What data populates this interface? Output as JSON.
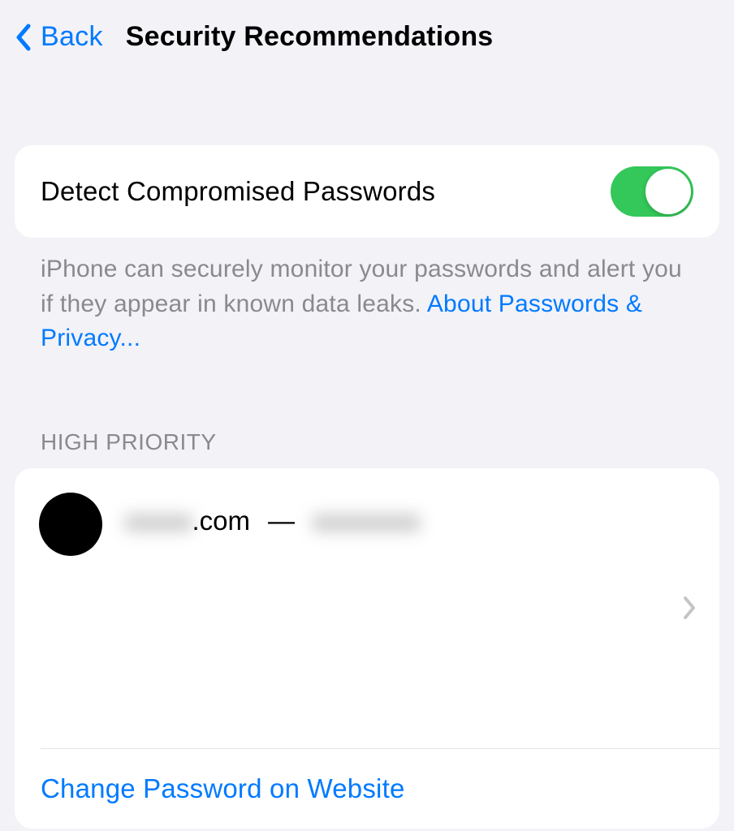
{
  "nav": {
    "back_label": "Back",
    "title": "Security Recommendations"
  },
  "detect_row": {
    "label": "Detect Compromised Passwords",
    "toggle_on": true
  },
  "footer": {
    "text": "iPhone can securely monitor your passwords and alert you if they appear in known data leaks. ",
    "link": "About Passwords & Privacy..."
  },
  "section": {
    "header": "HIGH PRIORITY"
  },
  "entry": {
    "domain_blur": "xxxxx",
    "domain_suffix": ".com",
    "separator": "—",
    "account_blur": "xxxxxxxx"
  },
  "action": {
    "change_password": "Change Password on Website"
  }
}
